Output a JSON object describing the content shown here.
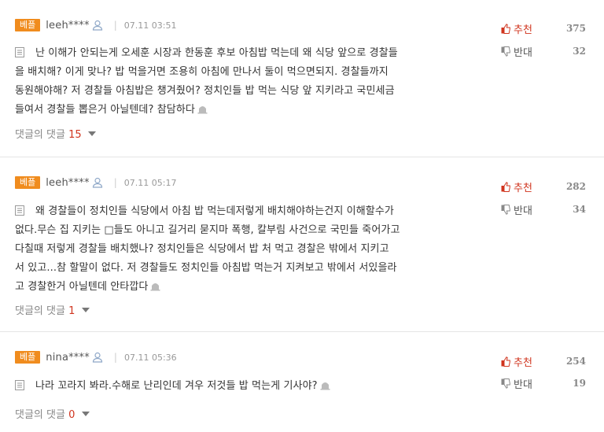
{
  "comments": [
    {
      "badge": "베플",
      "user": "leeh****",
      "date": "07.11 03:51",
      "lines": [
        "난 이해가 안되는게 오세훈 시장과 한동훈 후보 아침밥 먹는데 왜 식당 앞으로 경찰들",
        "을 배치해? 이게 맞나? 밥 먹을거면 조용히 아침에 만나서 둘이 먹으면되지. 경찰들까지",
        "동원해야해? 저 경찰들 아침밥은 챙겨줬어? 정치인들 밥 먹는 식당 앞 지키라고 국민세금",
        "들여서 경찰들 뽑은거 아닐텐데? 참담하다"
      ],
      "replies_label": "댓글의 댓글",
      "replies_count": "15",
      "up_label": "추천",
      "up_count": "375",
      "down_label": "반대",
      "down_count": "32"
    },
    {
      "badge": "베플",
      "user": "leeh****",
      "date": "07.11 05:17",
      "lines": [
        "왜 경찰들이 정치인들 식당에서 아침 밥 먹는데저렇게 배치해야하는건지 이해할수가",
        "없다.무슨 집 지키는 □들도 아니고 길거리 묻지마 폭행, 칼부림 사건으로 국민들 죽어가고",
        "다칠때 저렇게 경찰들 배치했나? 정치인들은 식당에서 밥 처 먹고 경찰은 밖에서 지키고",
        "서 있고...참 할말이 없다. 저 경찰들도 정치인들 아침밥 먹는거 지켜보고 밖에서 서있을라",
        "고 경찰한거 아닐텐데 안타깝다"
      ],
      "replies_label": "댓글의 댓글",
      "replies_count": "1",
      "up_label": "추천",
      "up_count": "282",
      "down_label": "반대",
      "down_count": "34"
    },
    {
      "badge": "베플",
      "user": "nina****",
      "date": "07.11 05:36",
      "lines": [
        "나라 꼬라지 봐라.수해로 난리인데 겨우 저것들 밥 먹는게 기사야?"
      ],
      "replies_label": "댓글의 댓글",
      "replies_count": "0",
      "up_label": "추천",
      "up_count": "254",
      "down_label": "반대",
      "down_count": "19"
    }
  ]
}
